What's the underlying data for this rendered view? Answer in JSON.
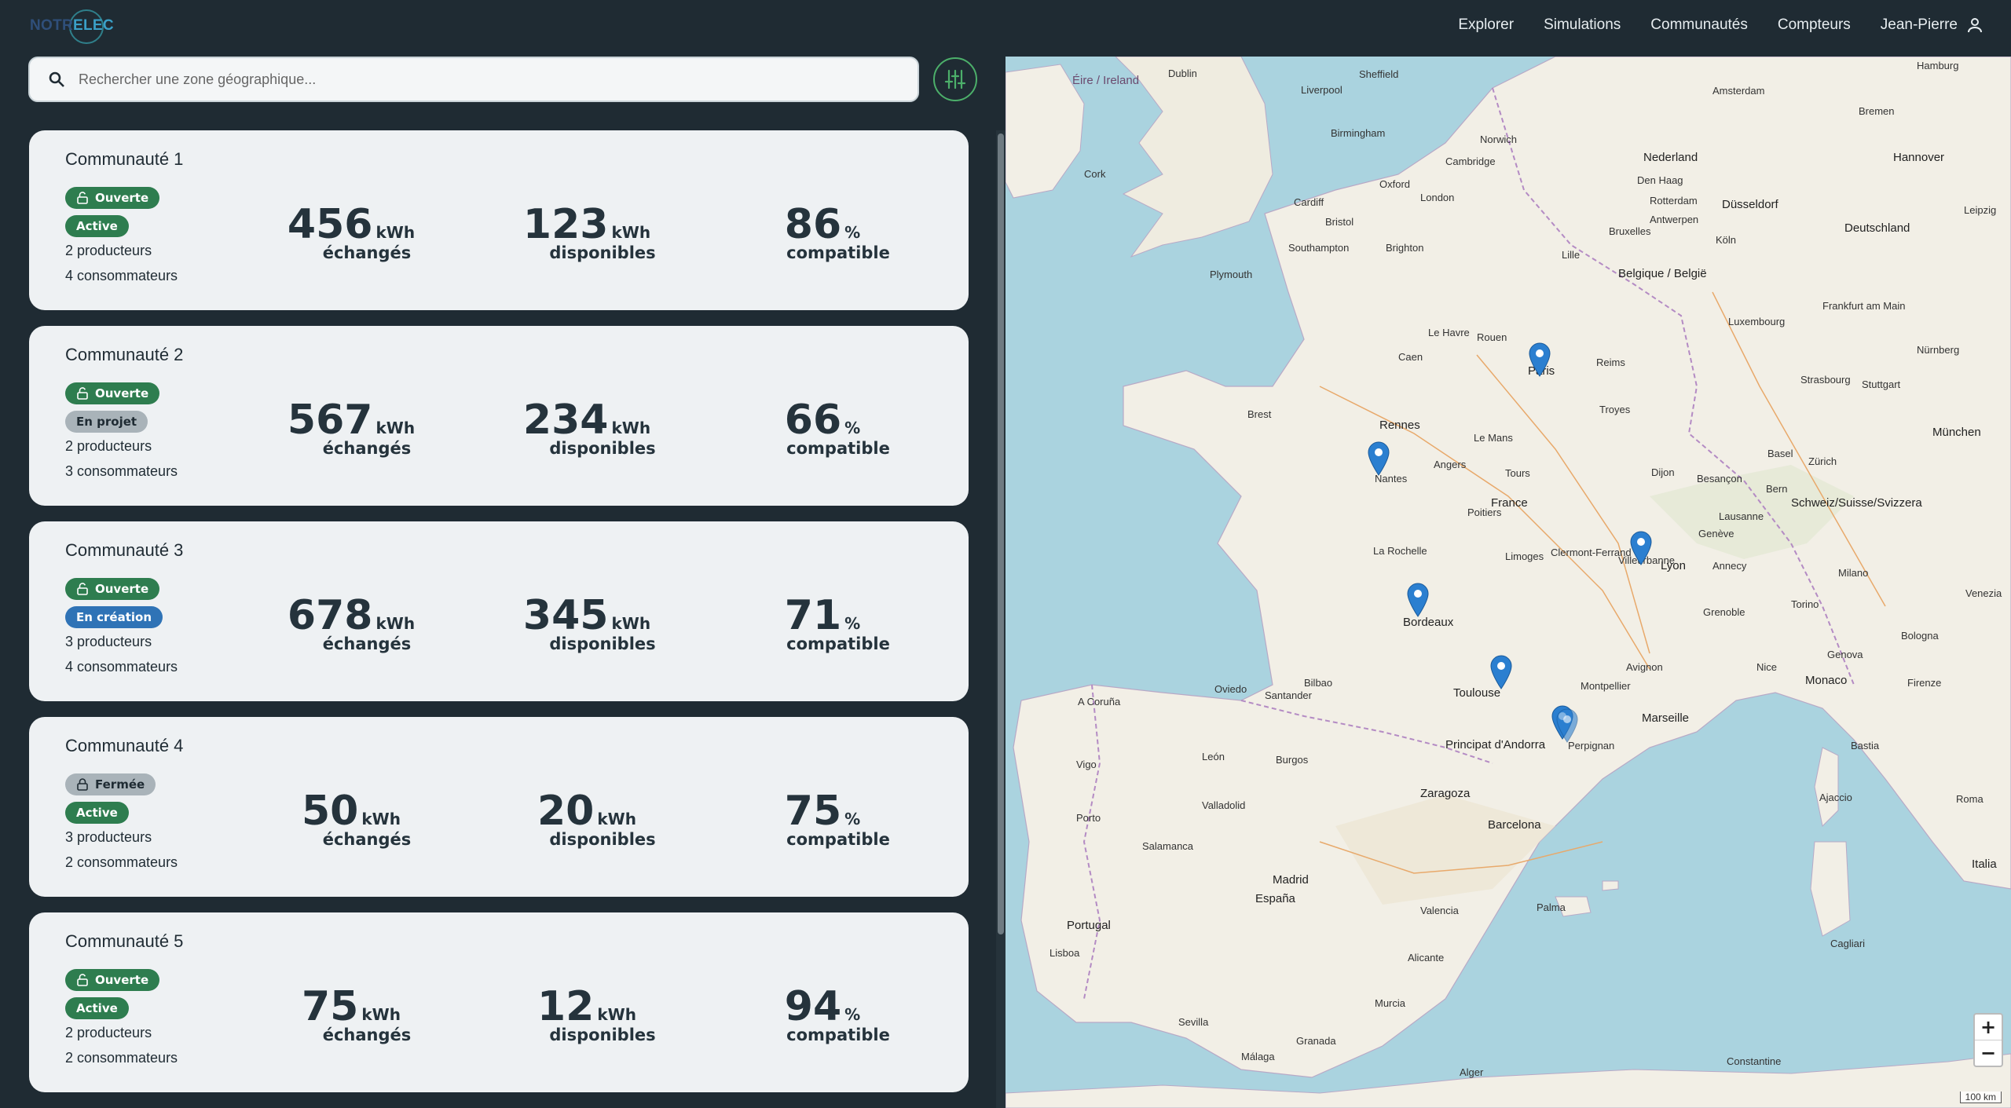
{
  "app": {
    "logo_left": "NOTR",
    "logo_right": "ELEC"
  },
  "nav": {
    "items": [
      "Explorer",
      "Simulations",
      "Communautés",
      "Compteurs"
    ],
    "user": "Jean-Pierre"
  },
  "search": {
    "placeholder": "Rechercher une zone géographique..."
  },
  "colors": {
    "background": "#1f2b33",
    "card": "#eef1f3",
    "green": "#2e7d4f",
    "grey": "#a9b3b9",
    "blue": "#2f73b6",
    "marker": "#2b7fd0"
  },
  "communities": [
    {
      "title": "Communauté 1",
      "access": "Ouverte",
      "access_type": "open",
      "status": "Active",
      "status_type": "green",
      "producers": "2 producteurs",
      "consumers": "4 consommateurs",
      "exchanged": "456",
      "exchanged_unit": "kWh",
      "exchanged_label": "échangés",
      "available": "123",
      "available_unit": "kWh",
      "available_label": "disponibles",
      "compatible": "86",
      "compatible_unit": "%",
      "compatible_label": "compatible"
    },
    {
      "title": "Communauté 2",
      "access": "Ouverte",
      "access_type": "open",
      "status": "En projet",
      "status_type": "grey",
      "producers": "2 producteurs",
      "consumers": "3 consommateurs",
      "exchanged": "567",
      "exchanged_unit": "kWh",
      "exchanged_label": "échangés",
      "available": "234",
      "available_unit": "kWh",
      "available_label": "disponibles",
      "compatible": "66",
      "compatible_unit": "%",
      "compatible_label": "compatible"
    },
    {
      "title": "Communauté 3",
      "access": "Ouverte",
      "access_type": "open",
      "status": "En création",
      "status_type": "blue",
      "producers": "3 producteurs",
      "consumers": "4 consommateurs",
      "exchanged": "678",
      "exchanged_unit": "kWh",
      "exchanged_label": "échangés",
      "available": "345",
      "available_unit": "kWh",
      "available_label": "disponibles",
      "compatible": "71",
      "compatible_unit": "%",
      "compatible_label": "compatible"
    },
    {
      "title": "Communauté 4",
      "access": "Fermée",
      "access_type": "closed",
      "status": "Active",
      "status_type": "green",
      "producers": "3 producteurs",
      "consumers": "2 consommateurs",
      "exchanged": "50",
      "exchanged_unit": "kWh",
      "exchanged_label": "échangés",
      "available": "20",
      "available_unit": "kWh",
      "available_label": "disponibles",
      "compatible": "75",
      "compatible_unit": "%",
      "compatible_label": "compatible"
    },
    {
      "title": "Communauté 5",
      "access": "Ouverte",
      "access_type": "open",
      "status": "Active",
      "status_type": "green",
      "producers": "2 producteurs",
      "consumers": "2 consommateurs",
      "exchanged": "75",
      "exchanged_unit": "kWh",
      "exchanged_label": "échangés",
      "available": "12",
      "available_unit": "kWh",
      "available_label": "disponibles",
      "compatible": "94",
      "compatible_unit": "%",
      "compatible_label": "compatible"
    }
  ],
  "map": {
    "zoom_in": "+",
    "zoom_out": "−",
    "scale": "100 km",
    "countries": [
      "Éire / Ireland",
      "France",
      "España",
      "Portugal",
      "Nederland",
      "Belgique / België",
      "Deutschland",
      "Schweiz/Suisse/Svizzera",
      "Principat d'Andorra",
      "Italia",
      "Monaco"
    ],
    "cities": [
      "Dublin",
      "Cork",
      "Liverpool",
      "Sheffield",
      "Birmingham",
      "Cardiff",
      "London",
      "Bristol",
      "Plymouth",
      "Southampton",
      "Brighton",
      "Norwich",
      "Cambridge",
      "Oxford",
      "Paris",
      "Reims",
      "Lille",
      "Rouen",
      "Le Havre",
      "Caen",
      "Rennes",
      "Brest",
      "Nantes",
      "Angers",
      "Le Mans",
      "Tours",
      "Poitiers",
      "La Rochelle",
      "Limoges",
      "Bordeaux",
      "Toulouse",
      "Montpellier",
      "Marseille",
      "Perpignan",
      "Avignon",
      "Lyon",
      "Villeurbanne",
      "Grenoble",
      "Annecy",
      "Genève",
      "Lausanne",
      "Bern",
      "Zürich",
      "Basel",
      "Strasbourg",
      "Troyes",
      "Dijon",
      "Besançon",
      "Clermont-Ferrand",
      "Nice",
      "Torino",
      "Milano",
      "Genova",
      "Bologna",
      "Firenze",
      "Roma",
      "Venezia",
      "Bilbao",
      "Zaragoza",
      "Barcelona",
      "Madrid",
      "Valencia",
      "Lisboa",
      "Porto",
      "Sevilla",
      "Málaga",
      "Granada",
      "Murcia",
      "Alicante",
      "Palma",
      "Bruxelles",
      "Amsterdam",
      "Den Haag",
      "Rotterdam",
      "Antwerpen",
      "Düsseldorf",
      "Köln",
      "Frankfurt am Main",
      "München",
      "Stuttgart",
      "Nürnberg",
      "Hannover",
      "Hamburg",
      "Bremen",
      "Leipzig",
      "Luxembourg",
      "Ajaccio",
      "Bastia",
      "Cagliari",
      "Alger",
      "Constantine",
      "Oviedo",
      "Santander",
      "A Coruña",
      "Vigo",
      "Valladolid",
      "Salamanca",
      "Burgos",
      "León"
    ],
    "marker_count": 7
  }
}
